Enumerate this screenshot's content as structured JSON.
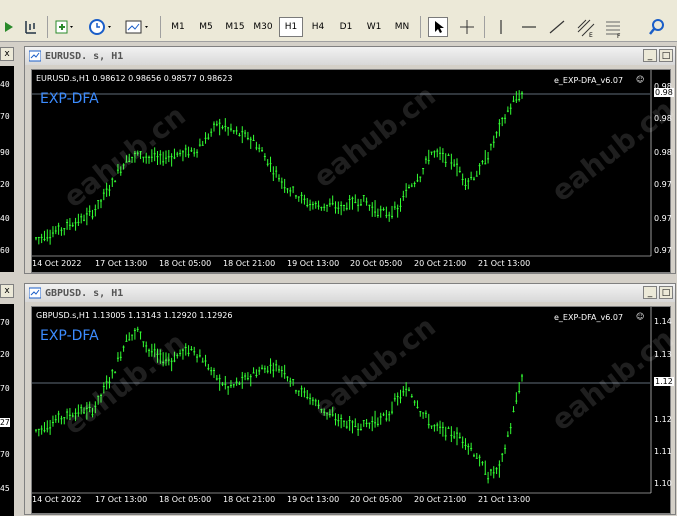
{
  "toolbar": {
    "timeframes": [
      "M1",
      "M5",
      "M15",
      "M30",
      "H1",
      "H4",
      "D1",
      "W1",
      "MN"
    ],
    "active_timeframe": "H1"
  },
  "left_panel": {
    "top_labels": [
      "40",
      "70",
      "90",
      "20",
      "40",
      "60"
    ],
    "bottom_labels": [
      "70",
      "20",
      "70",
      "27",
      "70",
      "45"
    ],
    "close_glyph": "x"
  },
  "windows": [
    {
      "title": "EURUSD. s, H1",
      "info": "EURUSD.s,H1  0.98612  0.98656  0.98577  0.98623",
      "ea_label": "e_EXP-DFA_v6.07",
      "ea_name": "EXP-DFA",
      "y_ticks": [
        "0.98",
        "0.98",
        "0.98",
        "0.97",
        "0.97",
        "0.97"
      ],
      "price_tag": "0.98",
      "x_ticks": [
        "14 Oct 2022",
        "17 Oct 13:00",
        "18 Oct 05:00",
        "18 Oct 21:00",
        "19 Oct 13:00",
        "20 Oct 05:00",
        "20 Oct 21:00",
        "21 Oct 13:00"
      ],
      "watermark": "eahub.cn"
    },
    {
      "title": "GBPUSD. s, H1",
      "info": "GBPUSD.s,H1  1.13005  1.13143  1.12920  1.12926",
      "ea_label": "e_EXP-DFA_v6.07",
      "ea_name": "EXP-DFA",
      "y_ticks": [
        "1.14",
        "1.13",
        "1.12",
        "1.12",
        "1.11",
        "1.10"
      ],
      "price_tag": "1.12",
      "x_ticks": [
        "14 Oct 2022",
        "17 Oct 13:00",
        "18 Oct 05:00",
        "18 Oct 21:00",
        "19 Oct 13:00",
        "20 Oct 05:00",
        "20 Oct 21:00",
        "21 Oct 13:00"
      ],
      "watermark": "eahub.cn"
    }
  ],
  "colors": {
    "candle": "#33ff33",
    "ea_name": "#3c8cff",
    "bg": "#000000",
    "grid_line": "#8090a0"
  },
  "series": {
    "eur": [
      0.97,
      0.9703,
      0.9707,
      0.9712,
      0.9716,
      0.9722,
      0.9736,
      0.9752,
      0.9768,
      0.9772,
      0.977,
      0.9768,
      0.9771,
      0.9773,
      0.9775,
      0.9784,
      0.9798,
      0.9794,
      0.9789,
      0.9786,
      0.9774,
      0.9759,
      0.9746,
      0.9739,
      0.973,
      0.9728,
      0.9728,
      0.9726,
      0.9731,
      0.9733,
      0.9724,
      0.9721,
      0.9724,
      0.9744,
      0.9755,
      0.9774,
      0.977,
      0.9765,
      0.9749,
      0.9755,
      0.9771,
      0.9795,
      0.9813,
      0.9824
    ],
    "gbp": [
      1.1205,
      1.121,
      1.1218,
      1.1222,
      1.1226,
      1.1226,
      1.1248,
      1.127,
      1.1302,
      1.131,
      1.129,
      1.1281,
      1.1279,
      1.1288,
      1.129,
      1.1276,
      1.126,
      1.125,
      1.1255,
      1.1263,
      1.1269,
      1.1273,
      1.1268,
      1.125,
      1.1242,
      1.1232,
      1.122,
      1.1215,
      1.121,
      1.1211,
      1.1215,
      1.1219,
      1.1239,
      1.1248,
      1.1228,
      1.121,
      1.1205,
      1.1201,
      1.1194,
      1.1178,
      1.1158,
      1.1165,
      1.121,
      1.1262
    ]
  }
}
